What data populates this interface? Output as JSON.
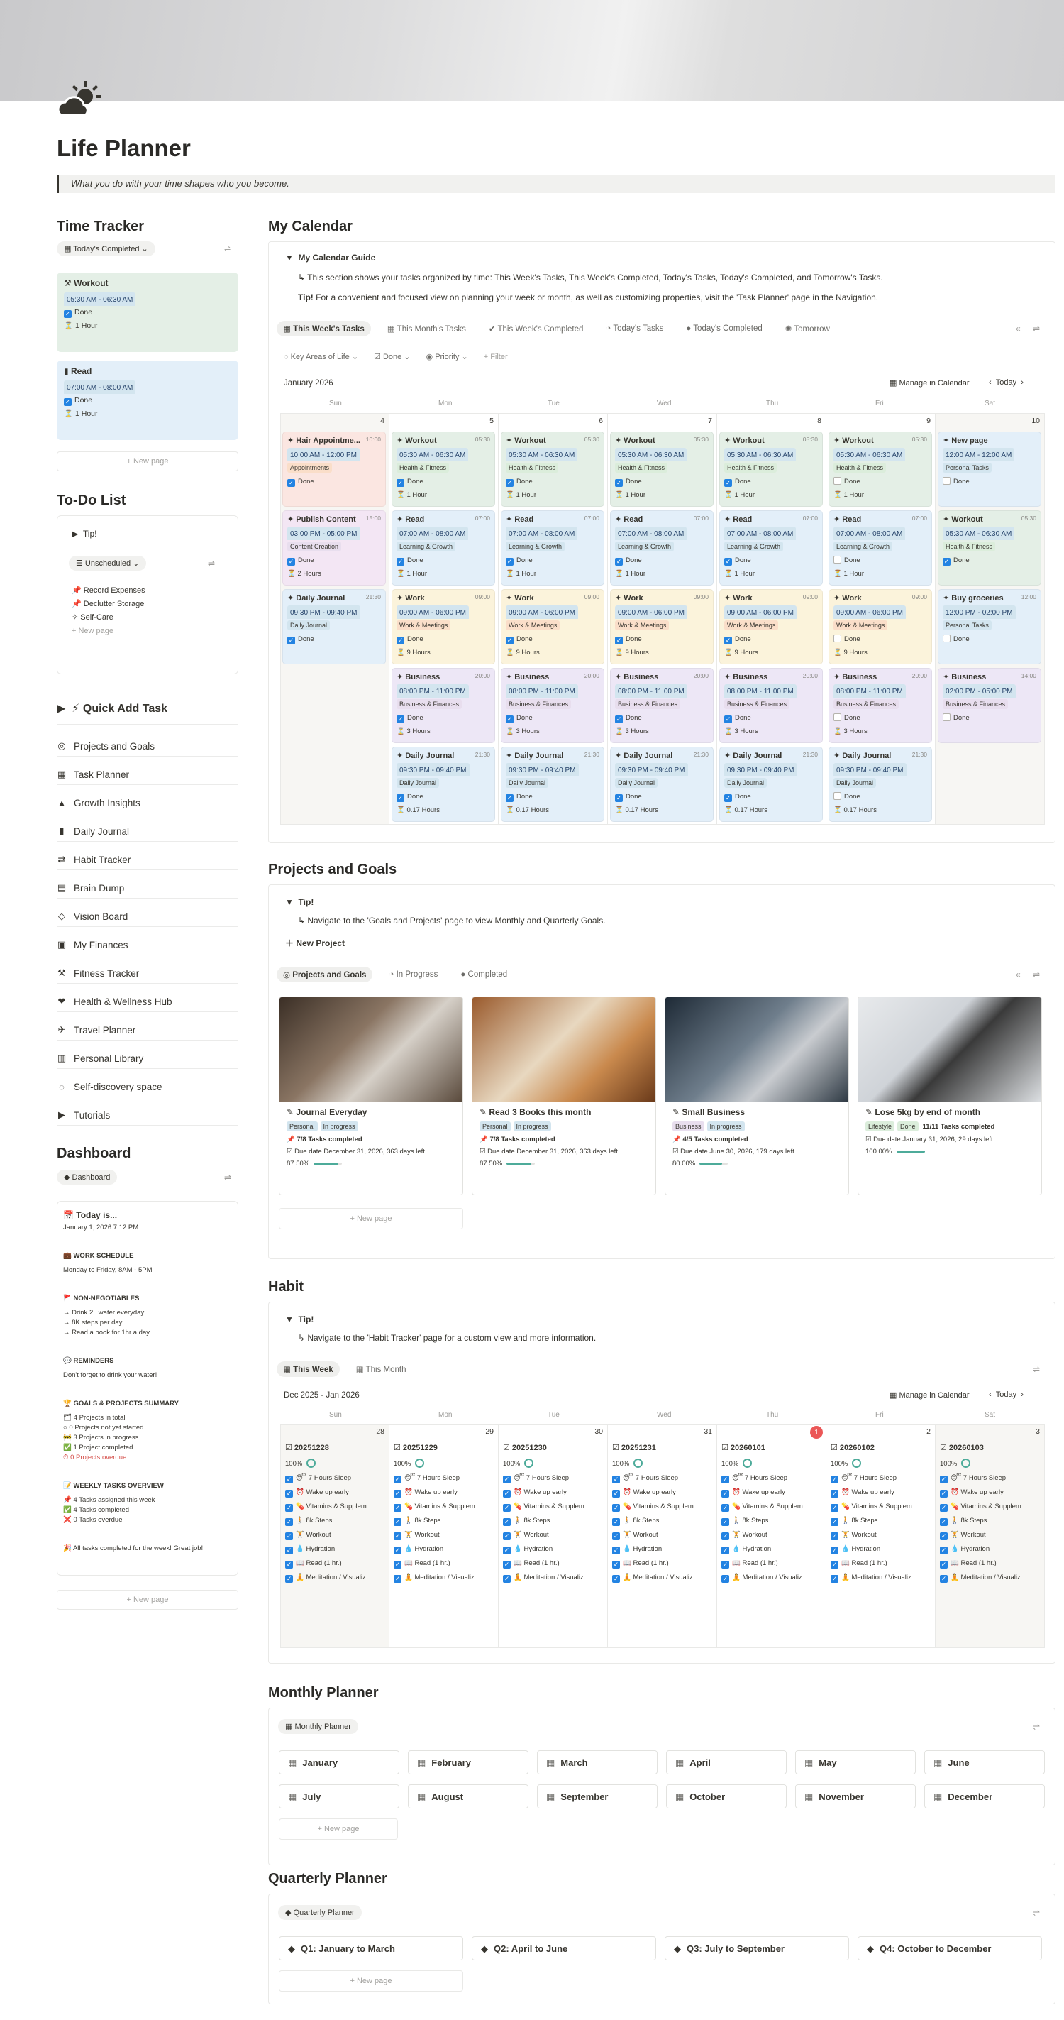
{
  "page": {
    "title": "Life Planner",
    "quote": "What you do with your time shapes who you become."
  },
  "colors": {
    "green": "#e4efe6",
    "blue": "#e3eff9",
    "red": "#fbe6e1",
    "pink": "#f3e6f4",
    "yellow": "#fbf3db",
    "purple": "#ede7f6",
    "accent": "#2383e2"
  },
  "time_tracker": {
    "title": "Time Tracker",
    "filter": "Today's Completed",
    "new_page": "New page",
    "items": [
      {
        "name": "Workout",
        "time": "05:30 AM - 06:30 AM",
        "done": "Done",
        "duration": "1 Hour"
      },
      {
        "name": "Read",
        "time": "07:00 AM - 08:00 AM",
        "done": "Done",
        "duration": "1 Hour"
      }
    ]
  },
  "todo": {
    "title": "To-Do List",
    "tip": "Tip!",
    "filter": "Unscheduled",
    "items": [
      "Record Expenses",
      "Declutter Storage",
      "Self-Care"
    ],
    "new_page": "New page"
  },
  "quick_add": {
    "label": "⚡ Quick Add Task"
  },
  "nav": [
    "Projects and Goals",
    "Task Planner",
    "Growth Insights",
    "Daily Journal",
    "Habit Tracker",
    "Brain Dump",
    "Vision Board",
    "My Finances",
    "Fitness Tracker",
    "Health & Wellness Hub",
    "Travel Planner",
    "Personal Library",
    "Self-discovery space",
    "Tutorials"
  ],
  "dashboard": {
    "title": "Dashboard",
    "tab": "Dashboard",
    "today_label": "Today is...",
    "date": "January 1, 2026 7:12 PM",
    "work_title": "WORK SCHEDULE",
    "work": "Monday to Friday, 8AM - 5PM",
    "nn_title": "NON-NEGOTIABLES",
    "nn": [
      "→ Drink 2L water everyday",
      "→ 8K steps per day",
      "→ Read a book for 1hr a day"
    ],
    "rem_title": "REMINDERS",
    "rem": "Don't forget to drink your water!",
    "gp_title": "GOALS & PROJECTS SUMMARY",
    "gp": [
      "4 Projects in total",
      "0 Projects not yet started",
      "3 Projects in progress",
      "1 Project completed",
      "0 Projects overdue"
    ],
    "wt_title": "WEEKLY TASKS OVERVIEW",
    "wt": [
      "4 Tasks assigned this week",
      "4 Tasks completed",
      "0 Tasks overdue"
    ],
    "final": "All tasks completed for the week! Great job!",
    "new_page": "New page"
  },
  "calendar": {
    "title": "My Calendar",
    "guide": "My Calendar Guide",
    "guide_text": "↳ This section shows your tasks organized by time: This Week's Tasks, This Week's Completed, Today's Tasks, Today's Completed, and Tomorrow's Tasks.",
    "tip_label": "Tip!",
    "tip_text": "For a convenient and focused view on planning your week or month, as well as customizing properties, visit the 'Task Planner' page in the Navigation.",
    "tabs": [
      "This Week's Tasks",
      "This Month's Tasks",
      "This Week's Completed",
      "Today's Tasks",
      "Today's Completed",
      "Tomorrow"
    ],
    "filters": [
      "Key Areas of Life",
      "Done",
      "Priority",
      "+ Filter"
    ],
    "month": "January 2026",
    "manage": "Manage in Calendar",
    "today": "Today",
    "days": [
      "Sun",
      "Mon",
      "Tue",
      "Wed",
      "Thu",
      "Fri",
      "Sat"
    ],
    "dates": [
      "4",
      "5",
      "6",
      "7",
      "8",
      "9",
      "10"
    ],
    "sun": [
      {
        "t": "Hair Appointme...",
        "tm": "10:00",
        "time": "10:00 AM - 12:00 PM",
        "tag": "Appointments",
        "tc": "#fadec9",
        "bg": "#fbe6e1",
        "done": true
      },
      {
        "t": "Publish Content",
        "tm": "15:00",
        "time": "03:00 PM - 05:00 PM",
        "tag": "Content Creation",
        "tc": "#e8deee",
        "bg": "#f3e6f4",
        "done": true,
        "dur": "2 Hours"
      },
      {
        "t": "Daily Journal",
        "tm": "21:30",
        "time": "09:30 PM - 09:40 PM",
        "tag": "Daily Journal",
        "tc": "#d3e5ef",
        "bg": "#e3eff9",
        "done": true
      }
    ],
    "week": [
      {
        "t": "Workout",
        "tm": "05:30",
        "time": "05:30 AM - 06:30 AM",
        "tag": "Health & Fitness",
        "tc": "#dbeddb",
        "bg": "#e4efe6",
        "dur": "1 Hour"
      },
      {
        "t": "Read",
        "tm": "07:00",
        "time": "07:00 AM - 08:00 AM",
        "tag": "Learning & Growth",
        "tc": "#d3e5ef",
        "bg": "#e3eff9",
        "dur": "1 Hour"
      },
      {
        "t": "Work",
        "tm": "09:00",
        "time": "09:00 AM - 06:00 PM",
        "tag": "Work & Meetings",
        "tc": "#fadec9",
        "bg": "#fbf3db",
        "dur": "9 Hours"
      },
      {
        "t": "Business",
        "tm": "20:00",
        "time": "08:00 PM - 11:00 PM",
        "tag": "Business & Finances",
        "tc": "#e8deee",
        "bg": "#ede7f6",
        "dur": "3 Hours"
      },
      {
        "t": "Daily Journal",
        "tm": "21:30",
        "time": "09:30 PM - 09:40 PM",
        "tag": "Daily Journal",
        "tc": "#d3e5ef",
        "bg": "#e3eff9",
        "dur": "0.17 Hours"
      }
    ],
    "sat": [
      {
        "t": "New page",
        "tm": "",
        "time": "12:00 AM - 12:00 AM",
        "tag": "Personal Tasks",
        "tc": "#d3e5ef",
        "bg": "#e3eff9"
      },
      {
        "t": "Workout",
        "tm": "05:30",
        "time": "05:30 AM - 06:30 AM",
        "tag": "Health & Fitness",
        "tc": "#dbeddb",
        "bg": "#e4efe6"
      },
      {
        "t": "Buy groceries",
        "tm": "12:00",
        "time": "12:00 PM - 02:00 PM",
        "tag": "Personal Tasks",
        "tc": "#d3e5ef",
        "bg": "#e3eff9"
      },
      {
        "t": "Business",
        "tm": "14:00",
        "time": "02:00 PM - 05:00 PM",
        "tag": "Business & Finances",
        "tc": "#e8deee",
        "bg": "#ede7f6"
      }
    ],
    "done_label": "Done"
  },
  "projects": {
    "title": "Projects and Goals",
    "tip": "Tip!",
    "tip_text": "↳ Navigate to the 'Goals and Projects' page to view Monthly and Quarterly Goals.",
    "new_project": "New Project",
    "tabs": [
      "Projects and Goals",
      "In Progress",
      "Completed"
    ],
    "new_page": "New page",
    "items": [
      {
        "name": "Journal Everyday",
        "cat": "Personal",
        "status": "In progress",
        "tasks": "7/8 Tasks completed",
        "due": "Due date December 31, 2026, 363 days left",
        "pct": "87.50%",
        "p": 0.875
      },
      {
        "name": "Read 3 Books this month",
        "cat": "Personal",
        "status": "In progress",
        "tasks": "7/8 Tasks completed",
        "due": "Due date December 31, 2026, 363 days left",
        "pct": "87.50%",
        "p": 0.875
      },
      {
        "name": "Small Business",
        "cat": "Business",
        "status": "In progress",
        "tasks": "4/5 Tasks completed",
        "due": "Due date June 30, 2026, 179 days left",
        "pct": "80.00%",
        "p": 0.8
      },
      {
        "name": "Lose 5kg by end of month",
        "cat": "Lifestyle",
        "status": "Done",
        "tasks": "11/11 Tasks completed",
        "due": "Due date January 31, 2026, 29 days left",
        "pct": "100.00%",
        "p": 1.0
      }
    ]
  },
  "habit": {
    "title": "Habit",
    "tip": "Tip!",
    "tip_text": "↳ Navigate to the 'Habit Tracker' page for a custom view and more information.",
    "tabs": [
      "This Week",
      "This Month"
    ],
    "range": "Dec 2025 - Jan 2026",
    "manage": "Manage in Calendar",
    "today": "Today",
    "dates": [
      "28",
      "29",
      "30",
      "31",
      "1",
      "2",
      "3"
    ],
    "titles": [
      "20251228",
      "20251229",
      "20251230",
      "20251231",
      "20260101",
      "20260102",
      "20260103"
    ],
    "pct": "100%",
    "items": [
      "7 Hours Sleep",
      "Wake up early",
      "Vitamins & Supplem...",
      "8k Steps",
      "Workout",
      "Hydration",
      "Read (1 hr.)",
      "Meditation / Visualiz..."
    ]
  },
  "monthly": {
    "title": "Monthly Planner",
    "tab": "Monthly Planner",
    "months": [
      "January",
      "February",
      "March",
      "April",
      "May",
      "June",
      "July",
      "August",
      "September",
      "October",
      "November",
      "December"
    ],
    "new_page": "New page"
  },
  "quarterly": {
    "title": "Quarterly Planner",
    "tab": "Quarterly Planner",
    "quarters": [
      "Q1: January to March",
      "Q2: April to June",
      "Q3: July to September",
      "Q4: October to December"
    ],
    "new_page": "New page"
  }
}
